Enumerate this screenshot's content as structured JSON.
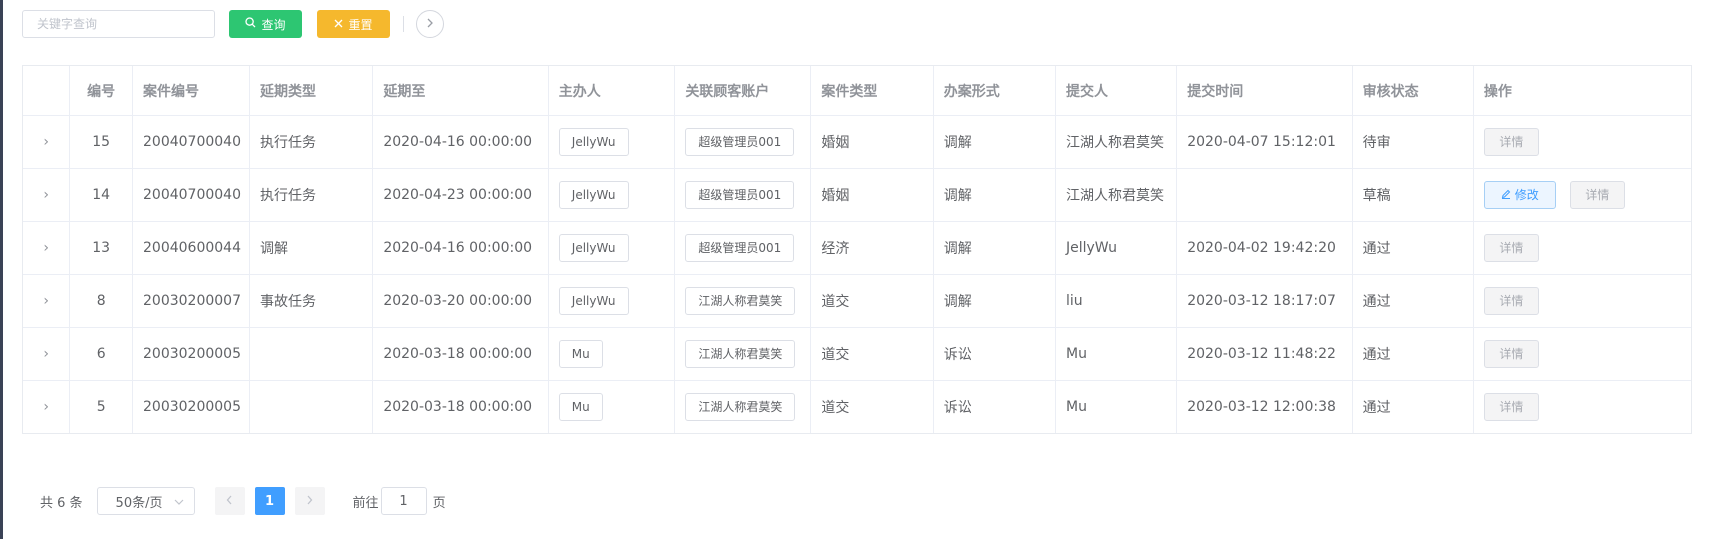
{
  "toolbar": {
    "search_placeholder": "关键字查询",
    "search_label": "查询",
    "reset_label": "重置",
    "search_icon": "search-icon",
    "reset_icon": "close-icon",
    "collapse_icon": "chevron-right-icon"
  },
  "table": {
    "columns": [
      "编号",
      "案件编号",
      "延期类型",
      "延期至",
      "主办人",
      "关联顾客账户",
      "案件类型",
      "办案形式",
      "提交人",
      "提交时间",
      "审核状态",
      "操作"
    ],
    "detail_label": "详情",
    "edit_label": "修改",
    "rows": [
      {
        "id": "15",
        "case_no": "20040700040",
        "delay_type": "执行任务",
        "delay_to": "2020-04-16 00:00:00",
        "host": "JellyWu",
        "account": "超级管理员001",
        "case_type": "婚姻",
        "form": "调解",
        "submitter": "江湖人称君莫笑",
        "submit_time": "2020-04-07 15:12:01",
        "status": "待审"
      },
      {
        "id": "14",
        "case_no": "20040700040",
        "delay_type": "执行任务",
        "delay_to": "2020-04-23 00:00:00",
        "host": "JellyWu",
        "account": "超级管理员001",
        "case_type": "婚姻",
        "form": "调解",
        "submitter": "江湖人称君莫笑",
        "submit_time": "",
        "status": "草稿"
      },
      {
        "id": "13",
        "case_no": "20040600044",
        "delay_type": "调解",
        "delay_to": "2020-04-16 00:00:00",
        "host": "JellyWu",
        "account": "超级管理员001",
        "case_type": "经济",
        "form": "调解",
        "submitter": "JellyWu",
        "submit_time": "2020-04-02 19:42:20",
        "status": "通过"
      },
      {
        "id": "8",
        "case_no": "20030200007",
        "delay_type": "事故任务",
        "delay_to": "2020-03-20 00:00:00",
        "host": "JellyWu",
        "account": "江湖人称君莫笑",
        "case_type": "道交",
        "form": "调解",
        "submitter": "liu",
        "submit_time": "2020-03-12 18:17:07",
        "status": "通过"
      },
      {
        "id": "6",
        "case_no": "20030200005",
        "delay_type": "",
        "delay_to": "2020-03-18 00:00:00",
        "host": "Mu",
        "account": "江湖人称君莫笑",
        "case_type": "道交",
        "form": "诉讼",
        "submitter": "Mu",
        "submit_time": "2020-03-12 11:48:22",
        "status": "通过"
      },
      {
        "id": "5",
        "case_no": "20030200005",
        "delay_type": "",
        "delay_to": "2020-03-18 00:00:00",
        "host": "Mu",
        "account": "江湖人称君莫笑",
        "case_type": "道交",
        "form": "诉讼",
        "submitter": "Mu",
        "submit_time": "2020-03-12 12:00:38",
        "status": "通过"
      }
    ]
  },
  "pagination": {
    "total_text": "共 6 条",
    "page_size": "50条/页",
    "current_page": "1",
    "goto_prefix": "前往",
    "goto_value": "1",
    "goto_suffix": "页"
  }
}
